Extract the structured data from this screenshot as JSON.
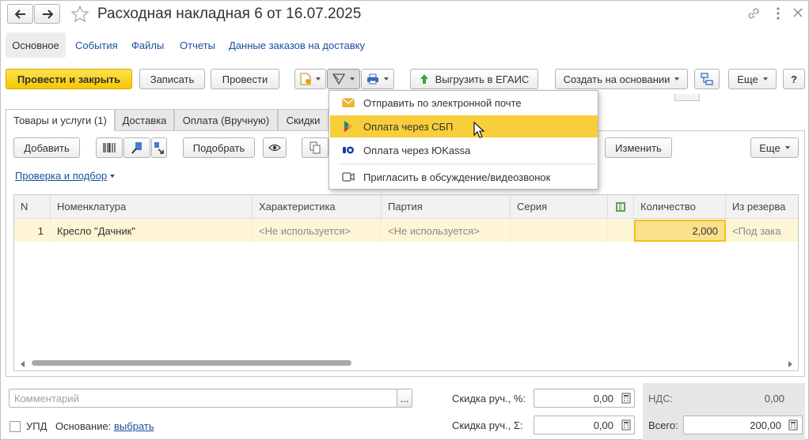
{
  "window": {
    "title": "Расходная накладная 6 от 16.07.2025"
  },
  "nav": {
    "tabs": [
      {
        "label": "Основное"
      },
      {
        "label": "События"
      },
      {
        "label": "Файлы"
      },
      {
        "label": "Отчеты"
      },
      {
        "label": "Данные заказов на доставку"
      }
    ]
  },
  "toolbar": {
    "post_close": "Провести и закрыть",
    "save": "Записать",
    "post": "Провести",
    "export_egais": "Выгрузить в ЕГАИС",
    "create_based": "Создать на основании",
    "more": "Еще",
    "help": "?"
  },
  "doc_tabs": [
    {
      "label": "Товары и услуги (1)"
    },
    {
      "label": "Доставка"
    },
    {
      "label": "Оплата (Вручную)"
    },
    {
      "label": "Скидки"
    }
  ],
  "table_toolbar": {
    "add": "Добавить",
    "select": "Подобрать",
    "change": "Изменить",
    "more": "Еще"
  },
  "check_link": "Проверка и подбор",
  "table": {
    "columns": [
      "N",
      "Номенклатура",
      "Характеристика",
      "Партия",
      "Серия",
      "Количество",
      "Из резерва"
    ],
    "rows": [
      {
        "n": "1",
        "item": "Кресло \"Дачник\"",
        "characteristic": "<Не используется>",
        "batch": "<Не используется>",
        "series": "",
        "qty": "2,000",
        "reserve": "<Под зака"
      }
    ]
  },
  "dropdown": {
    "items": [
      {
        "label": "Отправить по электронной почте",
        "icon": "envelope-icon"
      },
      {
        "label": "Оплата через СБП",
        "icon": "sbp-icon"
      },
      {
        "label": "Оплата через ЮKassa",
        "icon": "yookassa-icon"
      },
      {
        "label": "Пригласить в обсуждение/видеозвонок",
        "icon": "video-icon"
      }
    ]
  },
  "footer": {
    "comment_placeholder": "Комментарий",
    "comment_btn": "...",
    "discount_pct_label": "Скидка руч., %:",
    "discount_pct_value": "0,00",
    "discount_sum_label": "Скидка руч., Σ:",
    "discount_sum_value": "0,00",
    "vat_label": "НДС:",
    "vat_value": "0,00",
    "total_label": "Всего:",
    "total_value": "200,00",
    "upd_label": "УПД",
    "basis_label": "Основание:",
    "basis_link": "выбрать"
  },
  "colors": {
    "primary": "#f5c800",
    "highlight": "#f8ce3a",
    "link": "#1a4f9c",
    "row_selected": "#fdf5d4"
  }
}
